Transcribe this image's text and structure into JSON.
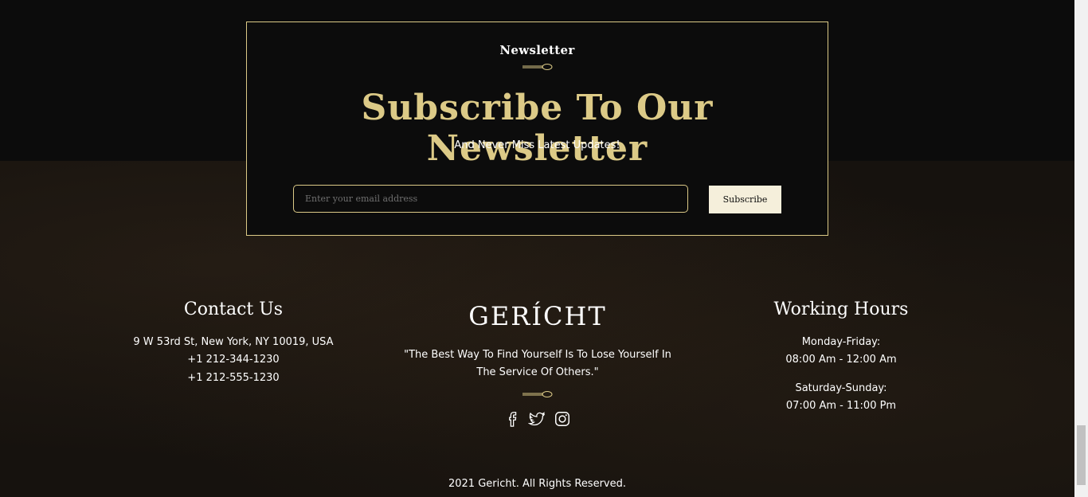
{
  "newsletter": {
    "subheading": "Newsletter",
    "title": "Subscribe To Our Newsletter",
    "tagline": "And Never Miss Latest Updates!",
    "email_placeholder": "Enter your email address",
    "email_value": "",
    "button_label": "Subscribe",
    "accent_color": "#dcca87"
  },
  "contact": {
    "title": "Contact Us",
    "address": "9 W 53rd St, New York, NY 10019, USA",
    "phone1": "+1 212-344-1230",
    "phone2": "+1 212-555-1230"
  },
  "brand": {
    "logo": "GERÍCHT",
    "quote_line1": "\"The Best Way To Find Yourself Is To Lose Yourself In",
    "quote_line2": "The Service Of Others.\"",
    "social_icons": [
      "facebook-icon",
      "twitter-icon",
      "instagram-icon"
    ]
  },
  "hours": {
    "title": "Working Hours",
    "weekdays_label": "Monday-Friday:",
    "weekdays_time": "08:00 Am - 12:00 Am",
    "weekend_label": "Saturday-Sunday:",
    "weekend_time": "07:00 Am - 11:00 Pm"
  },
  "footer": {
    "copyright": "2021 Gericht. All Rights Reserved."
  }
}
